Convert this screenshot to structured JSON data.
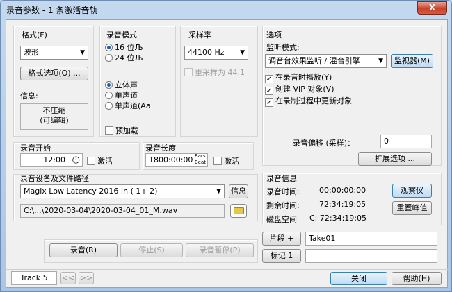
{
  "window": {
    "title": "录音参数 - 1 条激活音轨",
    "close": "X"
  },
  "format": {
    "label": "格式(F)",
    "value": "波形",
    "options_button": "格式选项(O) ...",
    "info_label": "信息:",
    "info_line1": "不压缩",
    "info_line2": "(可编辑)"
  },
  "mode": {
    "label": "录音模式",
    "r16": "16 位Љ",
    "r24": "24 位Љ",
    "stereo": "立体声",
    "mono": "单声道",
    "mono2": "单声道(Аа",
    "preload": "预加载"
  },
  "samplerate": {
    "label": "采样率",
    "value": "44100 Hz",
    "resample": "重采样为 44.1"
  },
  "options": {
    "label": "选项",
    "monitor_label": "监听模式:",
    "monitor_value": "调音台效果监听 / 混合引擎",
    "monitor_button": "监视器(M)",
    "c1": "在录音时播放(Y)",
    "c2": "创建 VIP 对象(V)",
    "c3": "在录制过程中更新对象",
    "offset_label": "录音偏移 (采样)：",
    "offset_value": "0",
    "extended_button": "扩展选项 ..."
  },
  "start": {
    "label": "录音开始",
    "time": "12:00",
    "activate": "激活"
  },
  "length": {
    "label": "录音长度",
    "time": "1800:00:00",
    "unit1": "Bars",
    "unit2": "Beat",
    "activate": "激活"
  },
  "device": {
    "label": "录音设备及文件路径",
    "value": "Magix Low Latency 2016 In ( 1+ 2)",
    "info_button": "信息",
    "path": "C:\\...\\2020-03-04\\2020-03-04_01_M.wav"
  },
  "recinfo": {
    "label": "录音信息",
    "time_label": "录音时间:",
    "time_value": "00:00:00:00",
    "remain_label": "剩余时间:",
    "remain_value": "72:34:19:05",
    "disk_label": "磁盘空间",
    "disk_value": "C: 72:34:19:05",
    "observe_button": "观察仪",
    "reset_button": "重置峰值"
  },
  "segment": {
    "button": "片段 +",
    "value": "Take01"
  },
  "marker": {
    "button": "标记 1",
    "value": ""
  },
  "transport": {
    "record": "录音(R)",
    "stop": "停止(S)",
    "pause": "录音暂停(P)"
  },
  "footer": {
    "track": "Track 5",
    "prev": "<<",
    "next": ">>",
    "close": "关闭",
    "help": "帮助(H)"
  }
}
